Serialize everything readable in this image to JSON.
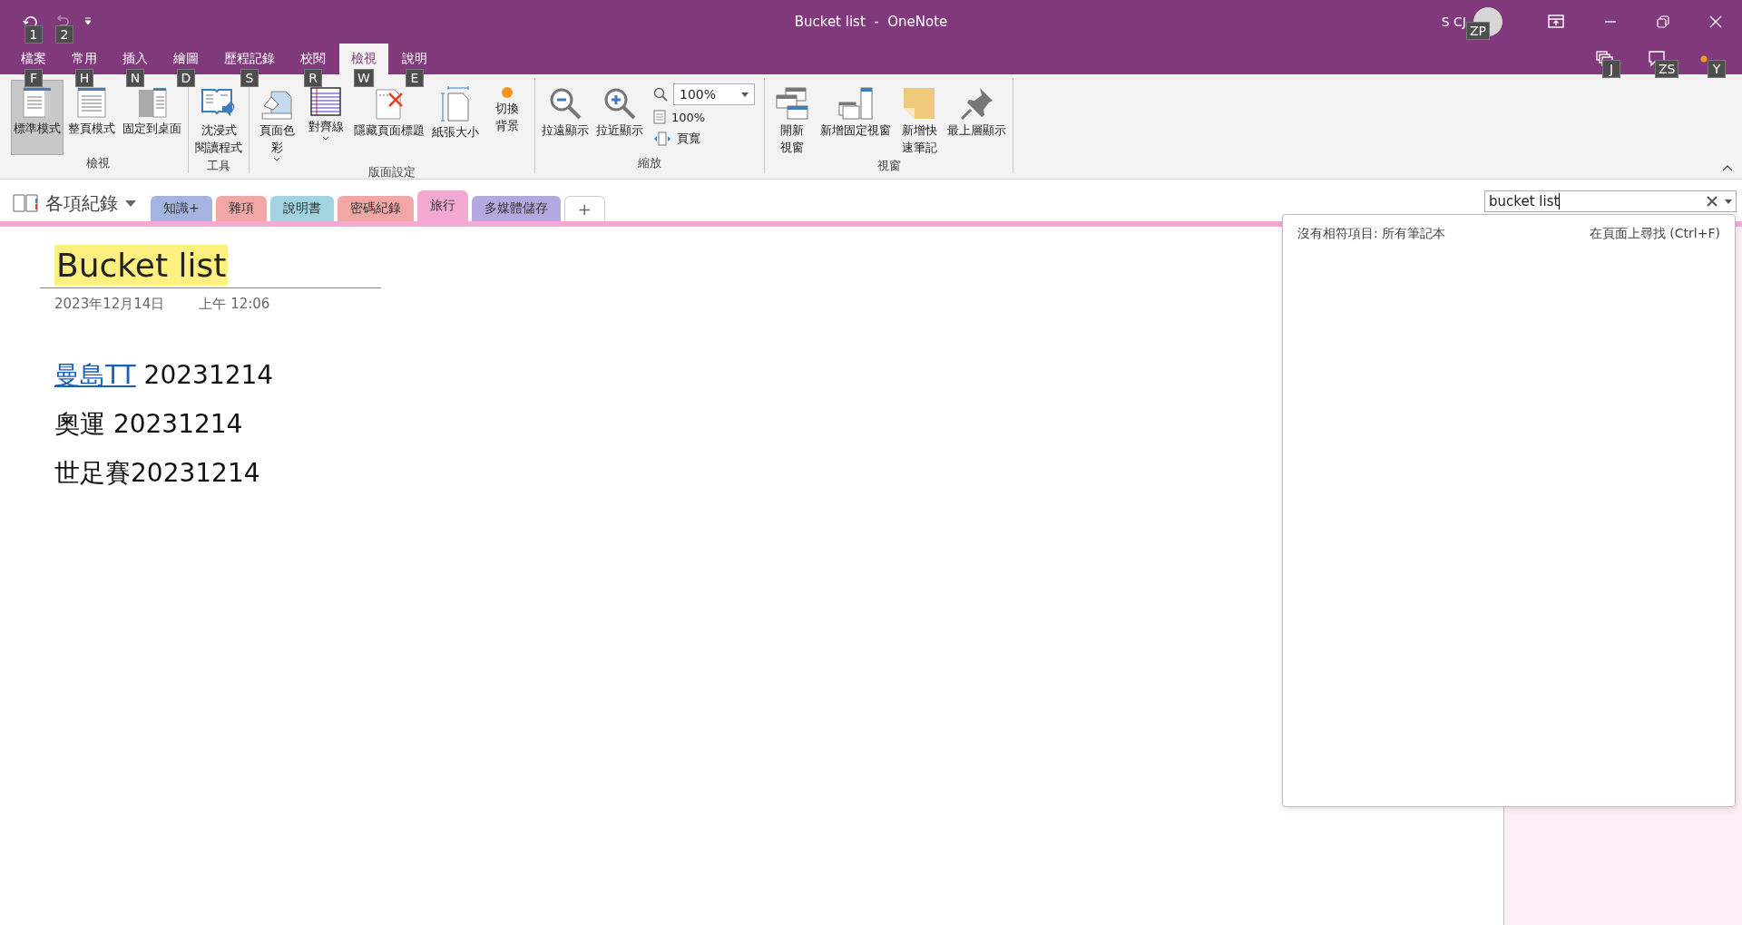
{
  "window": {
    "title": "Bucket list  -  OneNote",
    "user": "S CJ",
    "avatar_keytip": "ZP"
  },
  "quick_access": [
    {
      "keytip": "1",
      "disabled": false
    },
    {
      "keytip": "2",
      "disabled": true
    }
  ],
  "menu_tabs": [
    {
      "label": "檔案",
      "keytip": "F",
      "selected": false
    },
    {
      "label": "常用",
      "keytip": "H",
      "selected": false
    },
    {
      "label": "插入",
      "keytip": "N",
      "selected": false
    },
    {
      "label": "繪圖",
      "keytip": "D",
      "selected": false
    },
    {
      "label": "歷程記錄",
      "keytip": "S",
      "selected": false
    },
    {
      "label": "校閱",
      "keytip": "R",
      "selected": false
    },
    {
      "label": "檢視",
      "keytip": "W",
      "selected": true
    },
    {
      "label": "說明",
      "keytip": "E",
      "selected": false
    }
  ],
  "menu_right": [
    {
      "keytip": "J"
    },
    {
      "keytip": "ZS"
    },
    {
      "keytip": "Y"
    }
  ],
  "ribbon_groups": [
    {
      "label": "檢視",
      "items": [
        {
          "kind": "large",
          "label": "標準模式",
          "selected": true,
          "dropdown": false
        },
        {
          "kind": "large",
          "label": "整頁模式",
          "selected": false,
          "dropdown": false
        },
        {
          "kind": "large",
          "label": "固定到桌面",
          "selected": false,
          "dropdown": false
        }
      ]
    },
    {
      "label": "工具",
      "items": [
        {
          "kind": "large",
          "label": [
            "沈浸式",
            "閱讀程式"
          ],
          "selected": false,
          "dropdown": false
        }
      ]
    },
    {
      "label": "版面設定",
      "items": [
        {
          "kind": "large",
          "label": [
            "頁面色",
            "彩"
          ],
          "selected": false,
          "dropdown": true
        },
        {
          "kind": "large",
          "label": "對齊線",
          "selected": false,
          "dropdown": true
        },
        {
          "kind": "large",
          "label": "隱藏頁面標題",
          "selected": false,
          "dropdown": false
        },
        {
          "kind": "large",
          "label": "紙張大小",
          "selected": false,
          "dropdown": false
        },
        {
          "kind": "large",
          "label": [
            "切換",
            "背景"
          ],
          "selected": false,
          "dropdown": false
        }
      ]
    },
    {
      "label": "縮放",
      "items": [
        {
          "kind": "large",
          "label": "拉遠顯示",
          "selected": false,
          "dropdown": false
        },
        {
          "kind": "large",
          "label": "拉近顯示",
          "selected": false,
          "dropdown": false
        },
        {
          "kind": "stack",
          "rows": [
            {
              "kind": "combo",
              "value": "100%"
            },
            {
              "kind": "small",
              "label": "100%"
            },
            {
              "kind": "small",
              "label": "頁寬"
            }
          ]
        }
      ]
    },
    {
      "label": "視窗",
      "items": [
        {
          "kind": "large",
          "label": [
            "開新",
            "視窗"
          ],
          "selected": false,
          "dropdown": false
        },
        {
          "kind": "large",
          "label": "新增固定視窗",
          "selected": false,
          "dropdown": false
        },
        {
          "kind": "large",
          "label": [
            "新增快",
            "速筆記"
          ],
          "selected": false,
          "dropdown": false
        },
        {
          "kind": "large",
          "label": "最上層顯示",
          "selected": false,
          "dropdown": false
        }
      ]
    }
  ],
  "notebook": {
    "name": "各項紀錄"
  },
  "sections": [
    {
      "label": "知識+",
      "color": "#a3b4e0",
      "selected": false
    },
    {
      "label": "雜項",
      "color": "#f2a7a6",
      "selected": false
    },
    {
      "label": "說明書",
      "color": "#9fd4e0",
      "selected": false
    },
    {
      "label": "密碼紀錄",
      "color": "#f2a7a6",
      "selected": false
    },
    {
      "label": "旅行",
      "color": "#f3a9d1",
      "selected": true
    },
    {
      "label": "多媒體儲存",
      "color": "#b3a8df",
      "selected": false
    }
  ],
  "add_section": "+",
  "search": {
    "value": "bucket list",
    "no_match": "沒有相符項目: 所有筆記本",
    "find_on_page": "在頁面上尋找 (Ctrl+F)"
  },
  "page": {
    "title": "Bucket list",
    "date": "2023年12月14日",
    "time": "上午 12:06",
    "lines": [
      {
        "link": "曼島TT",
        "text": " 20231214"
      },
      {
        "text": "奧運 20231214"
      },
      {
        "text": "世足賽20231214"
      }
    ]
  }
}
